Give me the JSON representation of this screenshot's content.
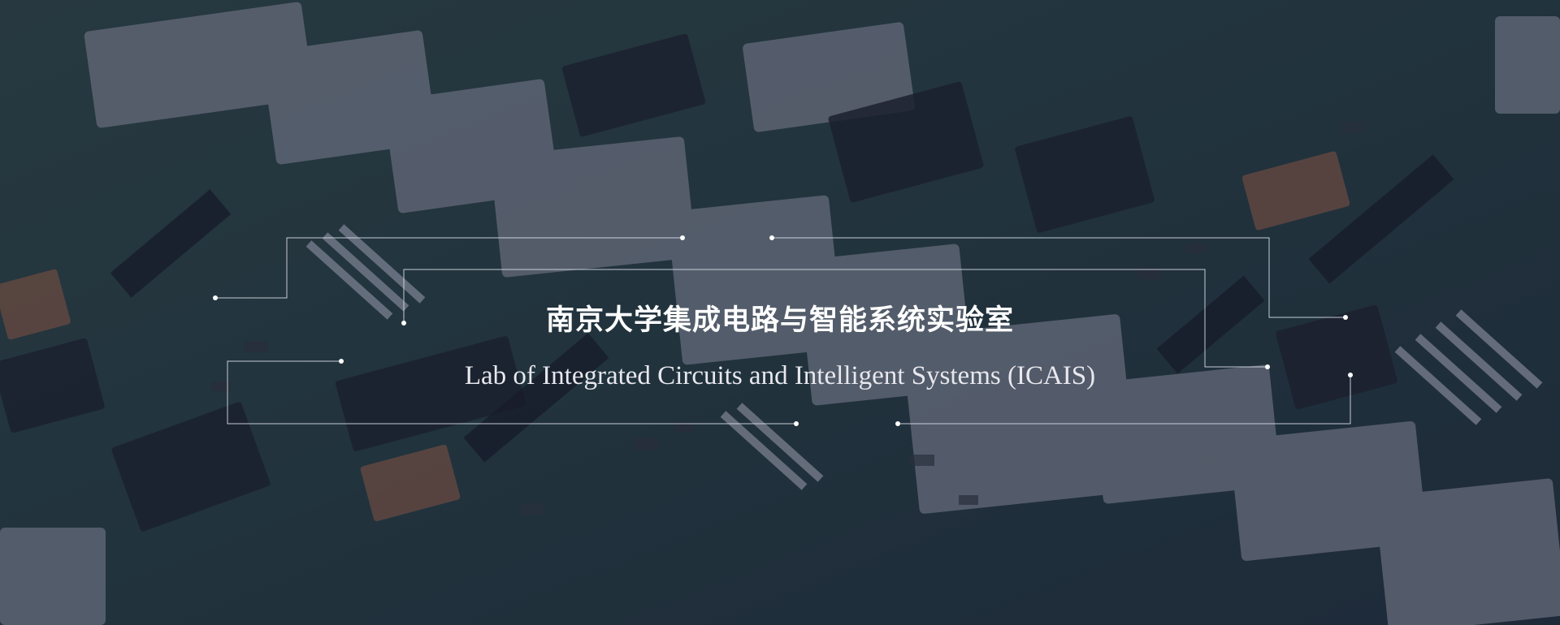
{
  "banner": {
    "title_cn": "南京大学集成电路与智能系统实验室",
    "title_en": "Lab of Integrated Circuits and Intelligent Systems (ICAIS)",
    "background": "circuit-board-photo",
    "colors": {
      "overlay": "#282e4e",
      "frame_line": "#d8dce6",
      "text": "#ffffff"
    }
  }
}
